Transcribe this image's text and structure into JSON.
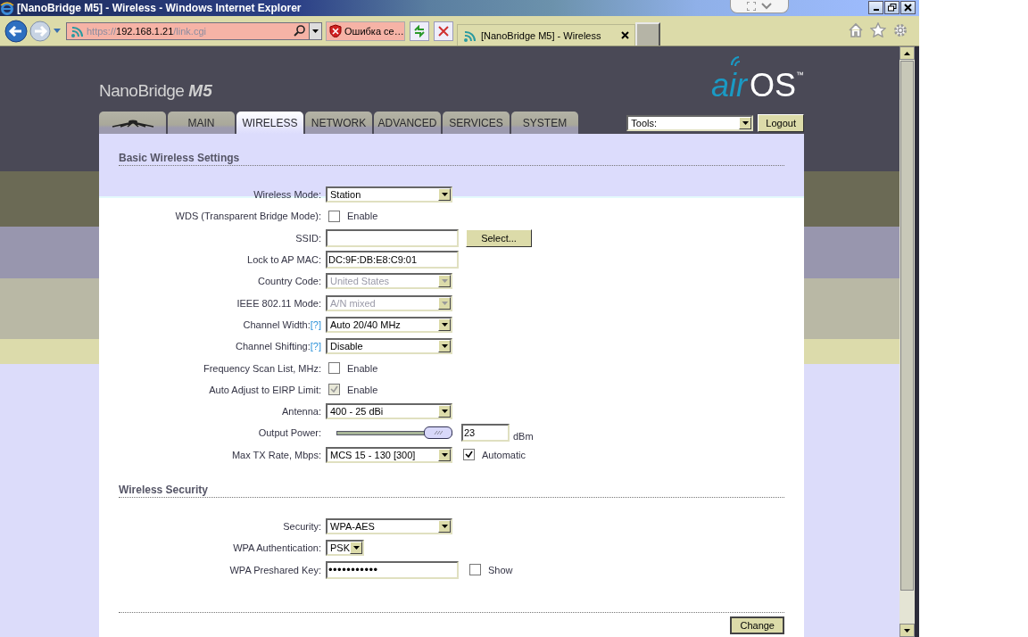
{
  "window": {
    "title": "[NanoBridge M5] - Wireless - Windows Internet Explorer"
  },
  "address_bar": {
    "scheme": "https://",
    "host": "192.168.1.21",
    "path": "/link.cgi"
  },
  "certificate_error": "Ошибка се…",
  "browser_tab": {
    "title": "[NanoBridge M5] - Wireless"
  },
  "page": {
    "brand": "NanoBridge",
    "model": "M5",
    "logo": {
      "air": "air",
      "os": "OS",
      "tm": "™"
    },
    "nav_tabs": [
      {
        "kind": "icon",
        "selected": false
      },
      {
        "kind": "text",
        "label": "MAIN",
        "selected": false
      },
      {
        "kind": "text",
        "label": "WIRELESS",
        "selected": true
      },
      {
        "kind": "text",
        "label": "NETWORK",
        "selected": false
      },
      {
        "kind": "text",
        "label": "ADVANCED",
        "selected": false
      },
      {
        "kind": "text",
        "label": "SERVICES",
        "selected": false
      },
      {
        "kind": "text",
        "label": "SYSTEM",
        "selected": false
      }
    ],
    "tools": {
      "value": "Tools:"
    },
    "logout": "Logout",
    "sections": [
      {
        "title": "Basic Wireless Settings",
        "rows": [
          {
            "kind": "select",
            "label": "Wireless Mode:",
            "value": "Station",
            "disabled": false
          },
          {
            "kind": "checkbox",
            "label": "WDS (Transparent Bridge Mode):",
            "checked": false,
            "disabled": false,
            "option": "Enable"
          },
          {
            "kind": "text",
            "label": "SSID:",
            "button": "Select..."
          },
          {
            "kind": "text",
            "label": "Lock to AP MAC:",
            "value": "DC:9F:DB:E8:C9:01"
          },
          {
            "kind": "select",
            "label": "Country Code:",
            "value": "United States",
            "disabled": true
          },
          {
            "kind": "select",
            "label": "IEEE 802.11 Mode:",
            "value": "A/N mixed",
            "disabled": true
          },
          {
            "kind": "select",
            "label": "Channel Width:",
            "help": "[?]",
            "value": "Auto 20/40 MHz",
            "disabled": false
          },
          {
            "kind": "select",
            "label": "Channel Shifting:",
            "help": "[?]",
            "value": "Disable",
            "disabled": false
          },
          {
            "kind": "checkbox",
            "label": "Frequency Scan List, MHz:",
            "checked": false,
            "disabled": false,
            "option": "Enable"
          },
          {
            "kind": "checkbox",
            "label": "Auto Adjust to EIRP Limit:",
            "checked": true,
            "disabled": true,
            "option": "Enable"
          },
          {
            "kind": "select",
            "label": "Antenna:",
            "value": "400 - 25 dBi",
            "disabled": false
          },
          {
            "kind": "slider",
            "label": "Output Power:",
            "level": 1,
            "value": "23",
            "unit": "dBm"
          },
          {
            "kind": "select",
            "label": "Max TX Rate, Mbps:",
            "value": "MCS 15 - 130 [300]",
            "disabled": false,
            "extra": {
              "checked": true,
              "option": "Automatic"
            }
          }
        ]
      },
      {
        "title": "Wireless Security",
        "rows": [
          {
            "kind": "select",
            "label": "Security:",
            "value": "WPA-AES",
            "disabled": false
          },
          {
            "kind": "shortselect",
            "label": "WPA Authentication:",
            "value": "PSK",
            "disabled": false
          },
          {
            "kind": "password",
            "label": "WPA Preshared Key:",
            "value": "•••••••••••",
            "extra": {
              "checked": false,
              "option": "Show"
            }
          }
        ]
      }
    ],
    "submit": "Change"
  }
}
